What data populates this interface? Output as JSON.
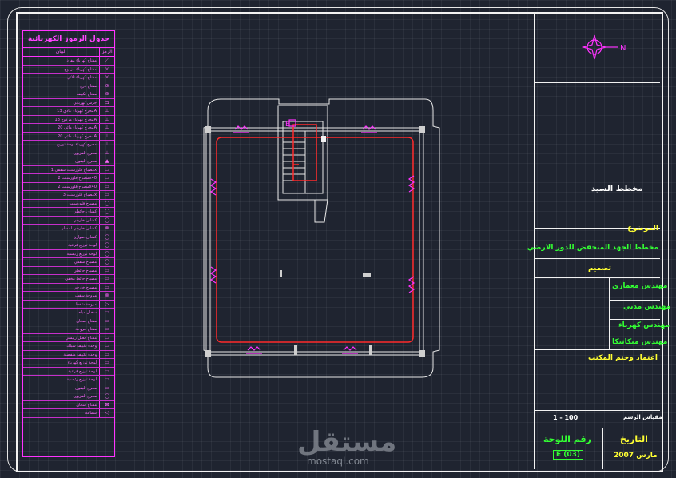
{
  "legend": {
    "title": "جدول الرموز الكهربائية",
    "col_desc": "البيان",
    "col_symbol": "الرمز",
    "rows": [
      {
        "desc": "مفتاح كهرباء مفرد",
        "symbol": "⟋"
      },
      {
        "desc": "مفتاح كهرباء مزدوج",
        "symbol": "⋎"
      },
      {
        "desc": "مفتاح كهرباء ثلاثي",
        "symbol": "⋎"
      },
      {
        "desc": "مفتاح درج",
        "symbol": "⊘"
      },
      {
        "desc": "مفتاح تكييف",
        "symbol": "⊛"
      },
      {
        "desc": "جرس كهربائي",
        "symbol": "⊐"
      },
      {
        "desc": "مخرج كهرباء عادي 13A",
        "symbol": "⊥"
      },
      {
        "desc": "مخرج كهرباء مزدوج 13A",
        "symbol": "⊥"
      },
      {
        "desc": "مخرج كهرباء مائي 20A",
        "symbol": "⊥"
      },
      {
        "desc": "مخرج كهرباء مائي 20A",
        "symbol": "⊥"
      },
      {
        "desc": "مخرج كهرباء لوحة توزيع",
        "symbol": "⊥"
      },
      {
        "desc": "مخرج تلفزيون",
        "symbol": "⊥"
      },
      {
        "desc": "مخرج تليفون",
        "symbol": "▲"
      },
      {
        "desc": "مصباح فلورسنت سقفي 1x",
        "symbol": "▭"
      },
      {
        "desc": "مصباح فلورسنت 2x40",
        "symbol": "▭"
      },
      {
        "desc": "مصباح فلورسنت 2x40",
        "symbol": "▭"
      },
      {
        "desc": "مصباح فلورسنت 3x",
        "symbol": "▭"
      },
      {
        "desc": "مصباح فلورسنت",
        "symbol": "◯"
      },
      {
        "desc": "كشاف حائطي",
        "symbol": "◯"
      },
      {
        "desc": "كشاف خارجي",
        "symbol": "◯"
      },
      {
        "desc": "كشاف خارجي لمسار",
        "symbol": "⊗"
      },
      {
        "desc": "كشاف طوارئ",
        "symbol": "◯"
      },
      {
        "desc": "لوحة توزيع فرعية",
        "symbol": "◯"
      },
      {
        "desc": "لوحة توزيع رئيسية",
        "symbol": "◯"
      },
      {
        "desc": "مصباح سقفي",
        "symbol": "◯"
      },
      {
        "desc": "مصباح حائطي",
        "symbol": "▭"
      },
      {
        "desc": "مصباح حائط مخفي",
        "symbol": "▭"
      },
      {
        "desc": "مصباح خارجي",
        "symbol": "▭"
      },
      {
        "desc": "مروحة سقف",
        "symbol": "⊗"
      },
      {
        "desc": "مروحة شفط",
        "symbol": "▷"
      },
      {
        "desc": "سخان مياه",
        "symbol": "▭"
      },
      {
        "desc": "مفتاح سخان",
        "symbol": "▭"
      },
      {
        "desc": "مفتاح مروحة",
        "symbol": "▭"
      },
      {
        "desc": "مفتاح فصل رئيسي",
        "symbol": "▭"
      },
      {
        "desc": "وحدة تكييف شباك",
        "symbol": "▭"
      },
      {
        "desc": "وحدة تكييف منفصلة",
        "symbol": "▭"
      },
      {
        "desc": "لوحة توزيع كهرباء",
        "symbol": "▭"
      },
      {
        "desc": "لوحة توزيع فرعية",
        "symbol": "▭"
      },
      {
        "desc": "لوحة توزيع رئيسية",
        "symbol": "▭"
      },
      {
        "desc": "مخرج تليفون",
        "symbol": "▭"
      },
      {
        "desc": "مخرج تلفزيون",
        "symbol": "◯"
      },
      {
        "desc": "مفتاح سخان",
        "symbol": "⊠"
      },
      {
        "desc": "سماعة",
        "symbol": "◁"
      }
    ]
  },
  "title_block": {
    "owner": "مخطط السيد",
    "subject_label": "الموضوع",
    "subject": "مخطط الجهد المنخفض للدور الارضي",
    "design_label": "تصميم",
    "engineer_architect": "مهندس معماري",
    "engineer_civil": "مهندس مدني",
    "engineer_electrical": "مهندس كهرباء",
    "engineer_mechanical": "مهندس ميكانيكا",
    "approval": "اعتماد وختم المكتب",
    "scale_label": "مقياس الرسم",
    "scale_value": "1 - 100",
    "sheet_label": "رقم اللوحة",
    "sheet_value": "E (03)",
    "date_label": "التاريخ",
    "date_value": "مارس 2007"
  },
  "compass": {
    "label": "N",
    "color": "#ff33ff"
  },
  "plan": {
    "wall_color": "#e8e8e8",
    "circuit_color": "#ff2a2a",
    "symbol_color": "#ff33ff",
    "stair_label": "E"
  },
  "watermark": {
    "arabic": "مستقل",
    "latin": "mostaql.com"
  }
}
